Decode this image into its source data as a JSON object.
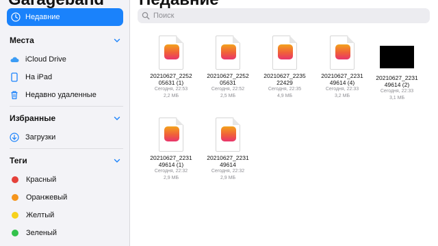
{
  "sidebar": {
    "app_title": "Garageband",
    "recents_label": "Недавние",
    "places": {
      "header": "Места",
      "items": [
        {
          "label": "iCloud Drive",
          "icon": "icloud-icon"
        },
        {
          "label": "На iPad",
          "icon": "ipad-icon"
        },
        {
          "label": "Недавно удаленные",
          "icon": "trash-icon"
        }
      ]
    },
    "favorites": {
      "header": "Избранные",
      "items": [
        {
          "label": "Загрузки",
          "icon": "download-icon"
        }
      ]
    },
    "tags": {
      "header": "Теги",
      "items": [
        {
          "label": "Красный",
          "color": "#e5413a"
        },
        {
          "label": "Оранжевый",
          "color": "#f5951d"
        },
        {
          "label": "Желтый",
          "color": "#f7d21c"
        },
        {
          "label": "Зеленый",
          "color": "#33c24c"
        }
      ]
    }
  },
  "main": {
    "title": "Недавние",
    "search_placeholder": "Поиск",
    "files": [
      {
        "name1": "20210627_2252",
        "name2": "05631 (1)",
        "date": "Сегодня, 22:53",
        "size": "2,2 МБ",
        "thumb": "garageband"
      },
      {
        "name1": "20210627_2252",
        "name2": "05631",
        "date": "Сегодня, 22:52",
        "size": "2,5 МБ",
        "thumb": "garageband"
      },
      {
        "name1": "20210627_2235",
        "name2": "22429",
        "date": "Сегодня, 22:35",
        "size": "4,9 МБ",
        "thumb": "garageband"
      },
      {
        "name1": "20210627_2231",
        "name2": "49614 (4)",
        "date": "Сегодня, 22:33",
        "size": "3,2 МБ",
        "thumb": "garageband"
      },
      {
        "name1": "20210627_2231",
        "name2": "49614 (2)",
        "date": "Сегодня, 22:33",
        "size": "3,1 МБ",
        "thumb": "black"
      },
      {
        "name1": "20210627_2231",
        "name2": "49614 (1)",
        "date": "Сегодня, 22:32",
        "size": "2,9 МБ",
        "thumb": "garageband"
      },
      {
        "name1": "20210627_2231",
        "name2": "49614",
        "date": "Сегодня, 22:32",
        "size": "2,9 МБ",
        "thumb": "garageband"
      }
    ]
  },
  "colors": {
    "accent": "#1a82fb"
  }
}
